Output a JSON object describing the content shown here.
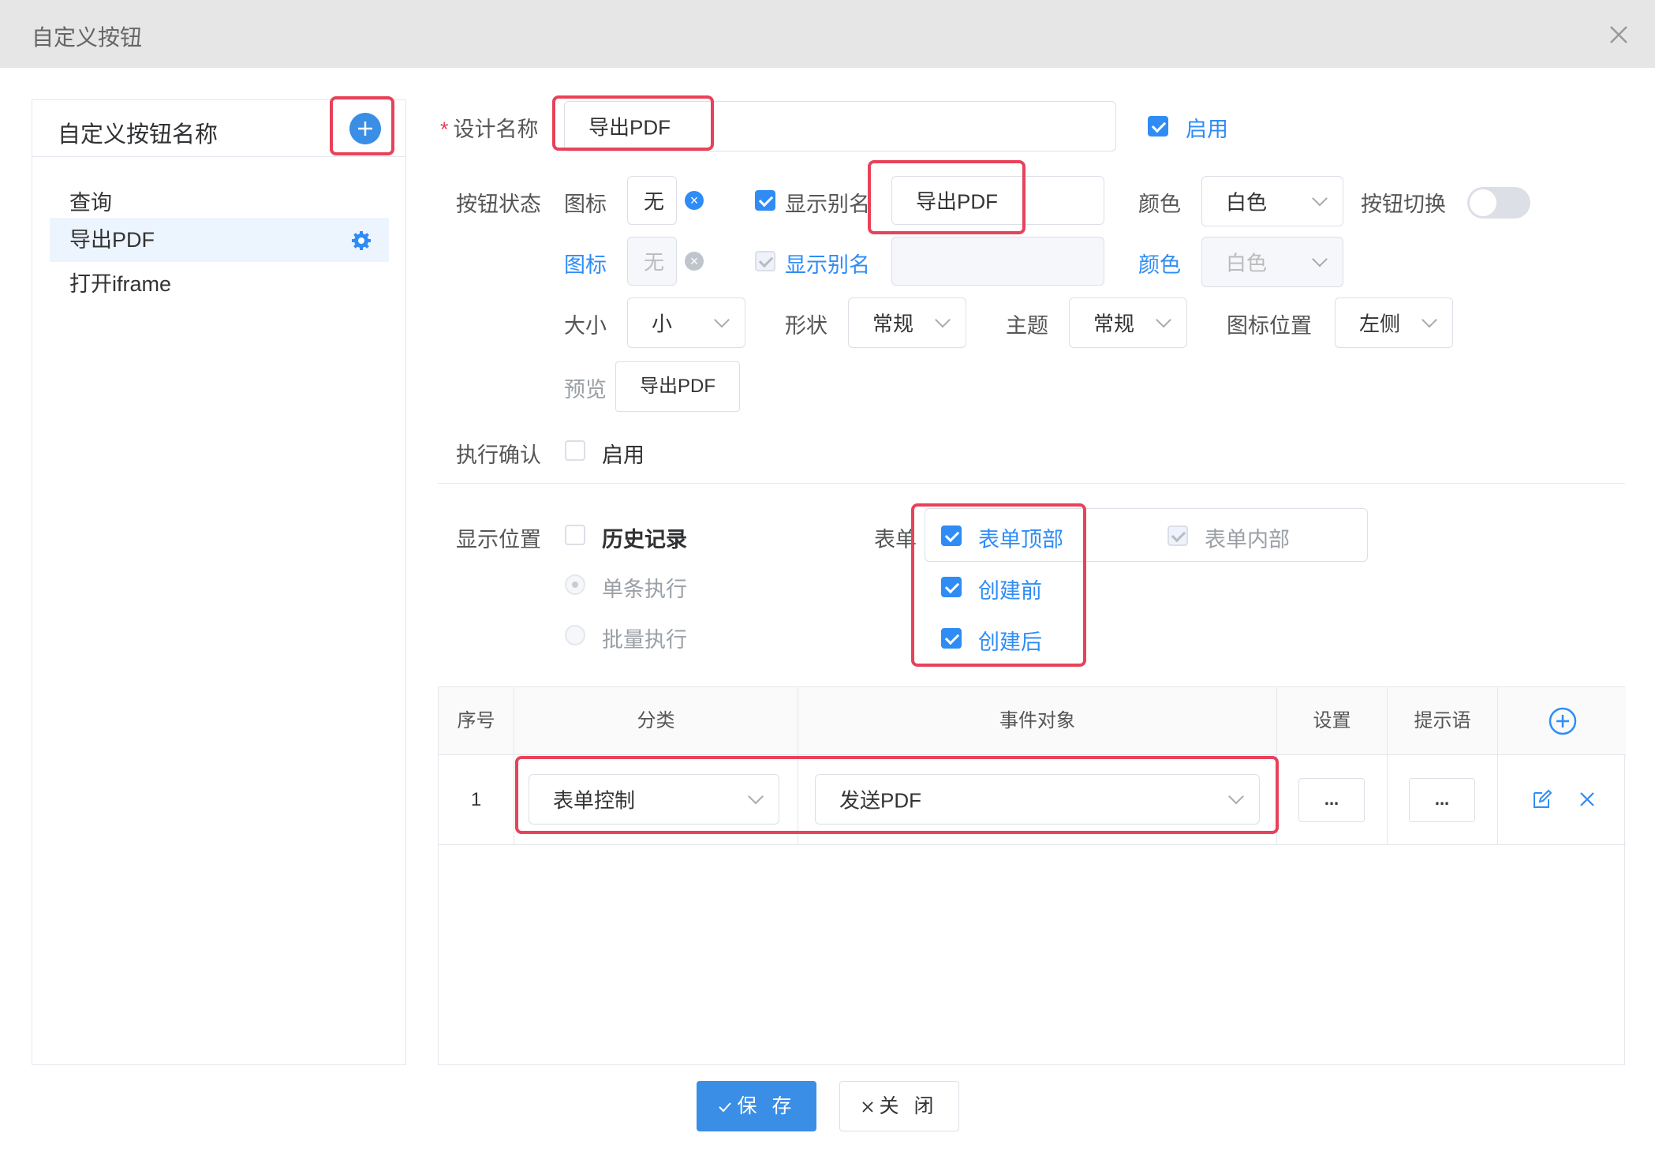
{
  "dialog": {
    "title": "自定义按钮"
  },
  "left": {
    "title": "自定义按钮名称",
    "items": [
      "查询",
      "导出PDF",
      "打开iframe"
    ]
  },
  "form": {
    "design_name_label": "设计名称",
    "design_name_value": "导出PDF",
    "enable_label": "启用",
    "button_state_label": "按钮状态",
    "icon_label": "图标",
    "icon_value": "无",
    "show_alias_label": "显示别名",
    "alias_value": "导出PDF",
    "color_label": "颜色",
    "color_value": "白色",
    "toggle_label": "按钮切换",
    "icon2_label": "图标",
    "icon2_value": "无",
    "show_alias2_label": "显示别名",
    "color2_label": "颜色",
    "color2_value": "白色",
    "size_label": "大小",
    "size_value": "小",
    "shape_label": "形状",
    "shape_value": "常规",
    "theme_label": "主题",
    "theme_value": "常规",
    "icon_pos_label": "图标位置",
    "icon_pos_value": "左侧",
    "preview_label": "预览",
    "preview_button": "导出PDF",
    "confirm_label": "执行确认",
    "confirm_enable": "启用",
    "display_pos_label": "显示位置",
    "history_label": "历史记录",
    "single_exec": "单条执行",
    "batch_exec": "批量执行",
    "form_label": "表单",
    "form_top": "表单顶部",
    "form_inner": "表单内部",
    "before_create": "创建前",
    "after_create": "创建后"
  },
  "table": {
    "headers": [
      "序号",
      "分类",
      "事件对象",
      "设置",
      "提示语"
    ],
    "rows": [
      {
        "index": "1",
        "category": "表单控制",
        "event": "发送PDF",
        "setting": "...",
        "tip": "..."
      }
    ]
  },
  "footer": {
    "save": "保 存",
    "close": "关 闭"
  },
  "colors": {
    "primary": "#2f8cf5",
    "highlight": "#e8425a"
  }
}
